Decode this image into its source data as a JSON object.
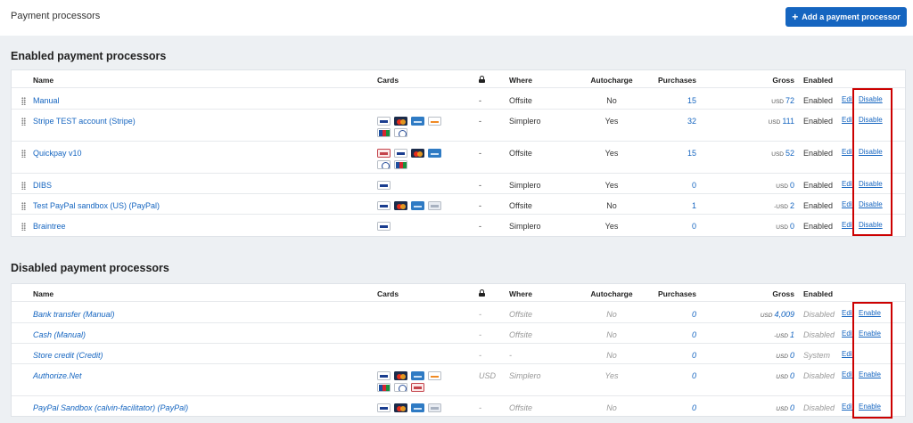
{
  "page_title": "Payment processors",
  "add_button_label": "Add a payment processor",
  "columns": {
    "name": "Name",
    "cards": "Cards",
    "where": "Where",
    "autocharge": "Autocharge",
    "purchases": "Purchases",
    "gross": "Gross",
    "enabled": "Enabled"
  },
  "enabled_section": {
    "title": "Enabled payment processors",
    "rows": [
      {
        "name": "Manual",
        "cards": [],
        "lock": "-",
        "where": "Offsite",
        "autocharge": "No",
        "purchases": "15",
        "currency": "USD",
        "gross": "72",
        "enabled": "Enabled",
        "edit": "Edit",
        "action": "Disable"
      },
      {
        "name": "Stripe TEST account (Stripe)",
        "cards": [
          "visa",
          "mastercard",
          "amex",
          "discover",
          "jcb",
          "diners"
        ],
        "lock": "-",
        "where": "Simplero",
        "autocharge": "Yes",
        "purchases": "32",
        "currency": "USD",
        "gross": "111",
        "enabled": "Enabled",
        "edit": "Edit",
        "action": "Disable"
      },
      {
        "name": "Quickpay v10",
        "cards": [
          "dankort",
          "visa",
          "mastercard",
          "amex",
          "diners",
          "jcb"
        ],
        "lock": "-",
        "where": "Offsite",
        "autocharge": "Yes",
        "purchases": "15",
        "currency": "USD",
        "gross": "52",
        "enabled": "Enabled",
        "edit": "Edit",
        "action": "Disable"
      },
      {
        "name": "DIBS",
        "cards": [
          "visa"
        ],
        "lock": "-",
        "where": "Simplero",
        "autocharge": "Yes",
        "purchases": "0",
        "currency": "USD",
        "gross": "0",
        "enabled": "Enabled",
        "edit": "Edit",
        "action": "Disable"
      },
      {
        "name": "Test PayPal sandbox (US) (PayPal)",
        "cards": [
          "visa",
          "mastercard",
          "amex",
          "maestro"
        ],
        "lock": "-",
        "where": "Offsite",
        "autocharge": "No",
        "purchases": "1",
        "currency": "-USD",
        "gross": "2",
        "enabled": "Enabled",
        "edit": "Edit",
        "action": "Disable"
      },
      {
        "name": "Braintree",
        "cards": [
          "visa"
        ],
        "lock": "-",
        "where": "Simplero",
        "autocharge": "Yes",
        "purchases": "0",
        "currency": "USD",
        "gross": "0",
        "enabled": "Enabled",
        "edit": "Edit",
        "action": "Disable"
      }
    ]
  },
  "disabled_section": {
    "title": "Disabled payment processors",
    "rows": [
      {
        "name": "Bank transfer (Manual)",
        "cards": [],
        "lock": "-",
        "where": "Offsite",
        "autocharge": "No",
        "purchases": "0",
        "currency": "USD",
        "gross": "4,009",
        "enabled": "Disabled",
        "edit": "Edit",
        "action": "Enable"
      },
      {
        "name": "Cash (Manual)",
        "cards": [],
        "lock": "-",
        "where": "Offsite",
        "autocharge": "No",
        "purchases": "0",
        "currency": "-USD",
        "gross": "1",
        "enabled": "Disabled",
        "edit": "Edit",
        "action": "Enable"
      },
      {
        "name": "Store credit (Credit)",
        "cards": [],
        "lock": "-",
        "where": "-",
        "autocharge": "No",
        "purchases": "0",
        "currency": "USD",
        "gross": "0",
        "enabled": "System",
        "edit": "Edit",
        "action": ""
      },
      {
        "name": "Authorize.Net",
        "cards": [
          "visa",
          "mastercard",
          "amex",
          "discover",
          "jcb",
          "diners",
          "dankort"
        ],
        "lock": "USD",
        "where": "Simplero",
        "autocharge": "Yes",
        "purchases": "0",
        "currency": "USD",
        "gross": "0",
        "enabled": "Disabled",
        "edit": "Edit",
        "action": "Enable"
      },
      {
        "name": "PayPal Sandbox (calvin-facilitator) (PayPal)",
        "cards": [
          "visa",
          "mastercard",
          "amex",
          "maestro"
        ],
        "lock": "-",
        "where": "Offsite",
        "autocharge": "No",
        "purchases": "0",
        "currency": "USD",
        "gross": "0",
        "enabled": "Disabled",
        "edit": "Edit",
        "action": "Enable"
      }
    ]
  },
  "colors": {
    "accent": "#1565c0",
    "highlight": "#cc0000",
    "background": "#edf0f3"
  }
}
